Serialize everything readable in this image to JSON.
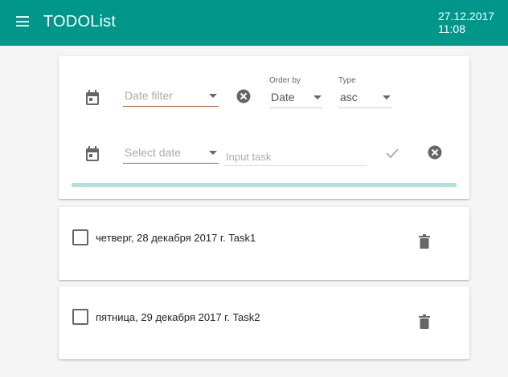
{
  "appbar": {
    "title": "TODOList",
    "date": "27.12.2017",
    "time": "11:08"
  },
  "filters": {
    "date_filter_placeholder": "Date filter",
    "order_by_label": "Order by",
    "order_by_value": "Date",
    "type_label": "Type",
    "type_value": "asc"
  },
  "new_task": {
    "select_date_placeholder": "Select date",
    "input_placeholder": "Input task"
  },
  "tasks": [
    {
      "text": "четверг, 28 декабря 2017 г. Task1",
      "checked": false
    },
    {
      "text": "пятница, 29 декабря 2017 г. Task2",
      "checked": false
    }
  ],
  "colors": {
    "primary": "#00968a",
    "progress": "#b4e0da",
    "error_underline": "#c0502a",
    "icon": "#666666"
  },
  "icons": [
    "menu-icon",
    "calendar-icon",
    "clear-icon",
    "check-icon",
    "delete-icon"
  ]
}
